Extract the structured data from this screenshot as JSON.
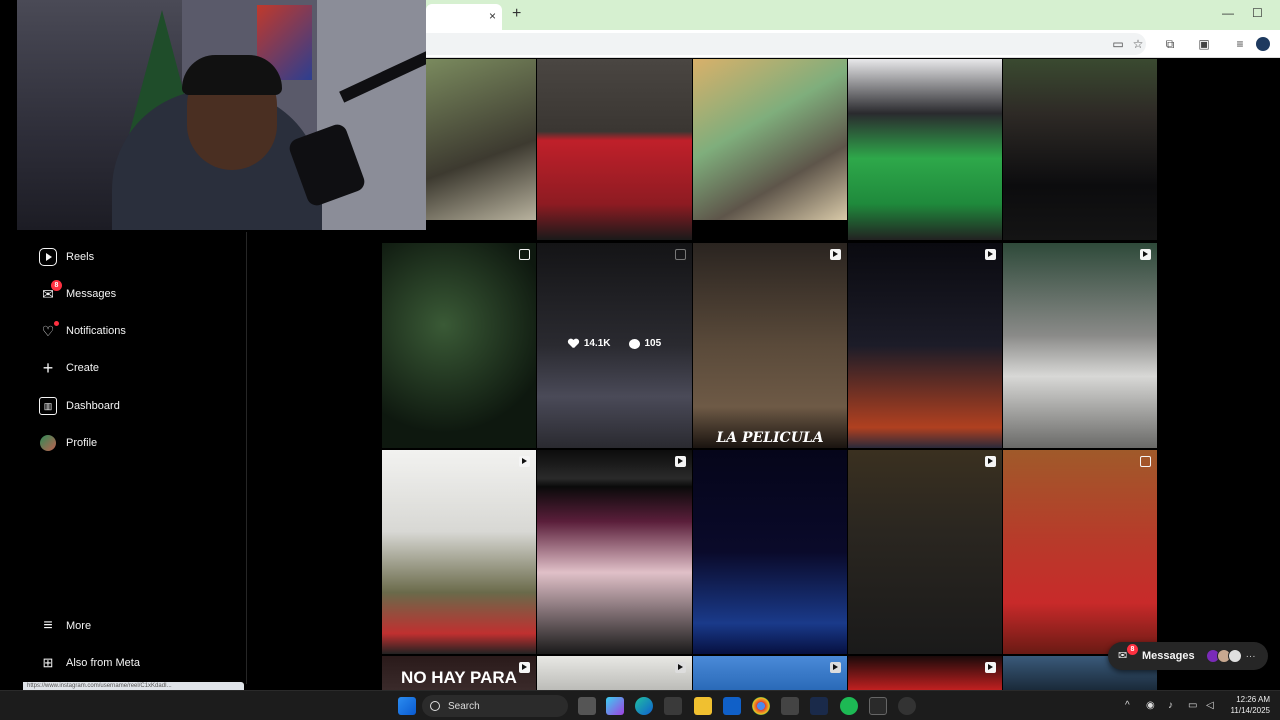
{
  "browser": {
    "tab_close": "×",
    "new_tab": "+",
    "minimize": "—",
    "maximize": "☐"
  },
  "sidebar": {
    "items": [
      {
        "label": "Reels",
        "icon": "reels-icon"
      },
      {
        "label": "Messages",
        "icon": "messages-icon",
        "badge": "8"
      },
      {
        "label": "Notifications",
        "icon": "heart-icon"
      },
      {
        "label": "Create",
        "icon": "plus-icon"
      },
      {
        "label": "Dashboard",
        "icon": "dashboard-icon"
      },
      {
        "label": "Profile",
        "icon": "avatar"
      }
    ],
    "bottom": [
      {
        "label": "More",
        "icon": "hamburger-icon"
      },
      {
        "label": "Also from Meta",
        "icon": "meta-apps-icon"
      }
    ]
  },
  "status_url": "https://www.instagram.com/username/reel/C1xKdadI...",
  "grid": {
    "hover_stats": {
      "likes": "14.1K",
      "comments": "105"
    },
    "overlay_texts": {
      "la_pelicula": "LA PELICULA",
      "no_hay_para": "NO HAY PARA"
    }
  },
  "messages_pill": {
    "label": "Messages",
    "badge": "8",
    "more": "···"
  },
  "taskbar": {
    "search": "Search",
    "time": "12:26 AM",
    "date": "11/14/2025"
  },
  "colors": {
    "badge_red": "#ff3040",
    "browser_tab_strip": "#d6f0d0",
    "page_bg": "#000000"
  }
}
